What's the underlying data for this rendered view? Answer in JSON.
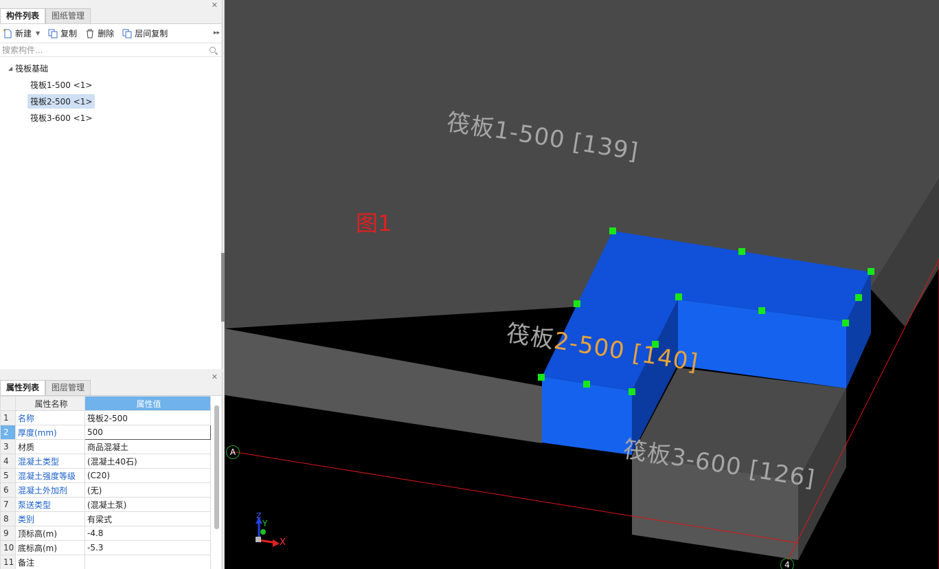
{
  "component_panel": {
    "tabs": [
      {
        "label": "构件列表",
        "active": true
      },
      {
        "label": "图纸管理",
        "active": false
      }
    ],
    "toolbar": {
      "new_label": "新建",
      "copy_label": "复制",
      "delete_label": "删除",
      "floor_copy_label": "层间复制"
    },
    "search": {
      "placeholder": "搜索构件..."
    },
    "tree": {
      "root": "筏板基础",
      "items": [
        {
          "label": "筏板1-500 <1>",
          "selected": false
        },
        {
          "label": "筏板2-500 <1>",
          "selected": true
        },
        {
          "label": "筏板3-600 <1>",
          "selected": false
        }
      ]
    }
  },
  "property_panel": {
    "tabs": [
      {
        "label": "属性列表",
        "active": true
      },
      {
        "label": "图层管理",
        "active": false
      }
    ],
    "headers": {
      "name": "属性名称",
      "value": "属性值"
    },
    "rows": [
      {
        "num": "1",
        "name": "名称",
        "value": "筏板2-500"
      },
      {
        "num": "2",
        "name": "厚度(mm)",
        "value": "500"
      },
      {
        "num": "3",
        "name": "材质",
        "value": "商品混凝土"
      },
      {
        "num": "4",
        "name": "混凝土类型",
        "value": "(混凝土40石)"
      },
      {
        "num": "5",
        "name": "混凝土强度等级",
        "value": "(C20)"
      },
      {
        "num": "6",
        "name": "混凝土外加剂",
        "value": "(无)"
      },
      {
        "num": "7",
        "name": "泵送类型",
        "value": "(混凝土泵)"
      },
      {
        "num": "8",
        "name": "类别",
        "value": "有梁式"
      },
      {
        "num": "9",
        "name": "顶标高(m)",
        "value": "-4.8"
      },
      {
        "num": "10",
        "name": "底标高(m)",
        "value": "-5.3"
      },
      {
        "num": "11",
        "name": "备注",
        "value": ""
      }
    ]
  },
  "viewport": {
    "label_slab1": "筏板1-500 [139]",
    "label_slab2_a": "筏板",
    "label_slab2_b": "2-500 [140]",
    "label_slab3": "筏板3-600 [126]",
    "figure_label": "图1",
    "axis_a": "A",
    "axis_4": "4",
    "gizmo": {
      "x": "X",
      "y": "Y",
      "z": "Z"
    },
    "colors": {
      "selected_slab": "#1256e0",
      "grip": "#19e619",
      "gridline": "#e01515",
      "slab": "#4a4a4a"
    }
  }
}
